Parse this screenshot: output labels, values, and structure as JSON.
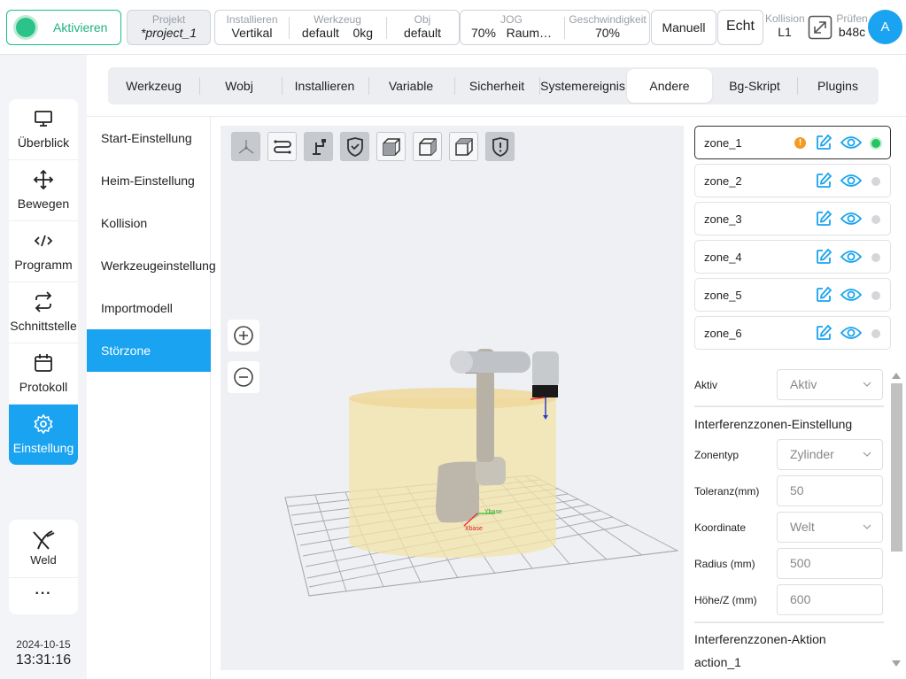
{
  "topbar": {
    "activate_label": "Aktivieren",
    "project_caption": "Projekt",
    "project_value": "*project_1",
    "install_caption": "Installieren",
    "install_value": "Vertikal",
    "tool_caption": "Werkzeug",
    "tool_value": "default",
    "payload_value": "0kg",
    "obj_caption": "Obj",
    "obj_value": "default",
    "jog_caption": "JOG",
    "jog_value": "70%   Raum…",
    "speed_caption": "Geschwindigkeit",
    "speed_value": "70%",
    "manual_label": "Manuell",
    "real_label": "Echt",
    "collision_caption": "Kollision",
    "collision_value": "L1",
    "check_caption": "Prüfen",
    "check_value": "b48c",
    "avatar_letter": "A"
  },
  "nav": {
    "items": [
      {
        "label": "Überblick",
        "icon": "monitor-icon"
      },
      {
        "label": "Bewegen",
        "icon": "move-arrows-icon"
      },
      {
        "label": "Programm",
        "icon": "code-icon"
      },
      {
        "label": "Schnittstelle",
        "icon": "swap-arrows-icon"
      },
      {
        "label": "Protokoll",
        "icon": "calendar-icon"
      },
      {
        "label": "Einstellung",
        "icon": "gear-icon"
      }
    ],
    "weld_label": "Weld",
    "more_label": "···"
  },
  "datetime": {
    "date": "2024-10-15",
    "time": "13:31:16"
  },
  "tabs": [
    "Werkzeug",
    "Wobj",
    "Installieren",
    "Variable",
    "Sicherheit",
    "Systemereignis",
    "Andere",
    "Bg-Skript",
    "Plugins"
  ],
  "active_tab": "Andere",
  "settings": [
    "Start-Einstellung",
    "Heim-Einstellung",
    "Kollision",
    "Werkzeugeinstellung",
    "Importmodell",
    "Störzone"
  ],
  "active_setting": "Störzone",
  "viewport": {
    "axis_x_label": "Xbase",
    "axis_y_label": "Ybase",
    "colors": {
      "zone_fill": "#f3e3a8",
      "grid": "#9a9da1",
      "robot": "#c9c4b8"
    }
  },
  "zones": [
    {
      "name": "zone_1",
      "warning": true,
      "active": true
    },
    {
      "name": "zone_2",
      "warning": false,
      "active": false
    },
    {
      "name": "zone_3",
      "warning": false,
      "active": false
    },
    {
      "name": "zone_4",
      "warning": false,
      "active": false
    },
    {
      "name": "zone_5",
      "warning": false,
      "active": false
    },
    {
      "name": "zone_6",
      "warning": false,
      "active": false
    }
  ],
  "zone_warning_glyph": "!",
  "props": {
    "enabled_label": "Aktiv",
    "enabled_value": "Aktiv",
    "section_title": "Interferenzzonen-Einstellung",
    "zone_type_label": "Zonentyp",
    "zone_type_value": "Zylinder",
    "tolerance_label": "Toleranz(mm)",
    "tolerance_value": "50",
    "coord_label": "Koordinate",
    "coord_value": "Welt",
    "radius_label": "Radius (mm)",
    "radius_value": "500",
    "height_label": "Höhe/Z (mm)",
    "height_value": "600",
    "action_title": "Interferenzzonen-Aktion",
    "action_value": "action_1"
  },
  "accent_color": "#1aa3f0"
}
